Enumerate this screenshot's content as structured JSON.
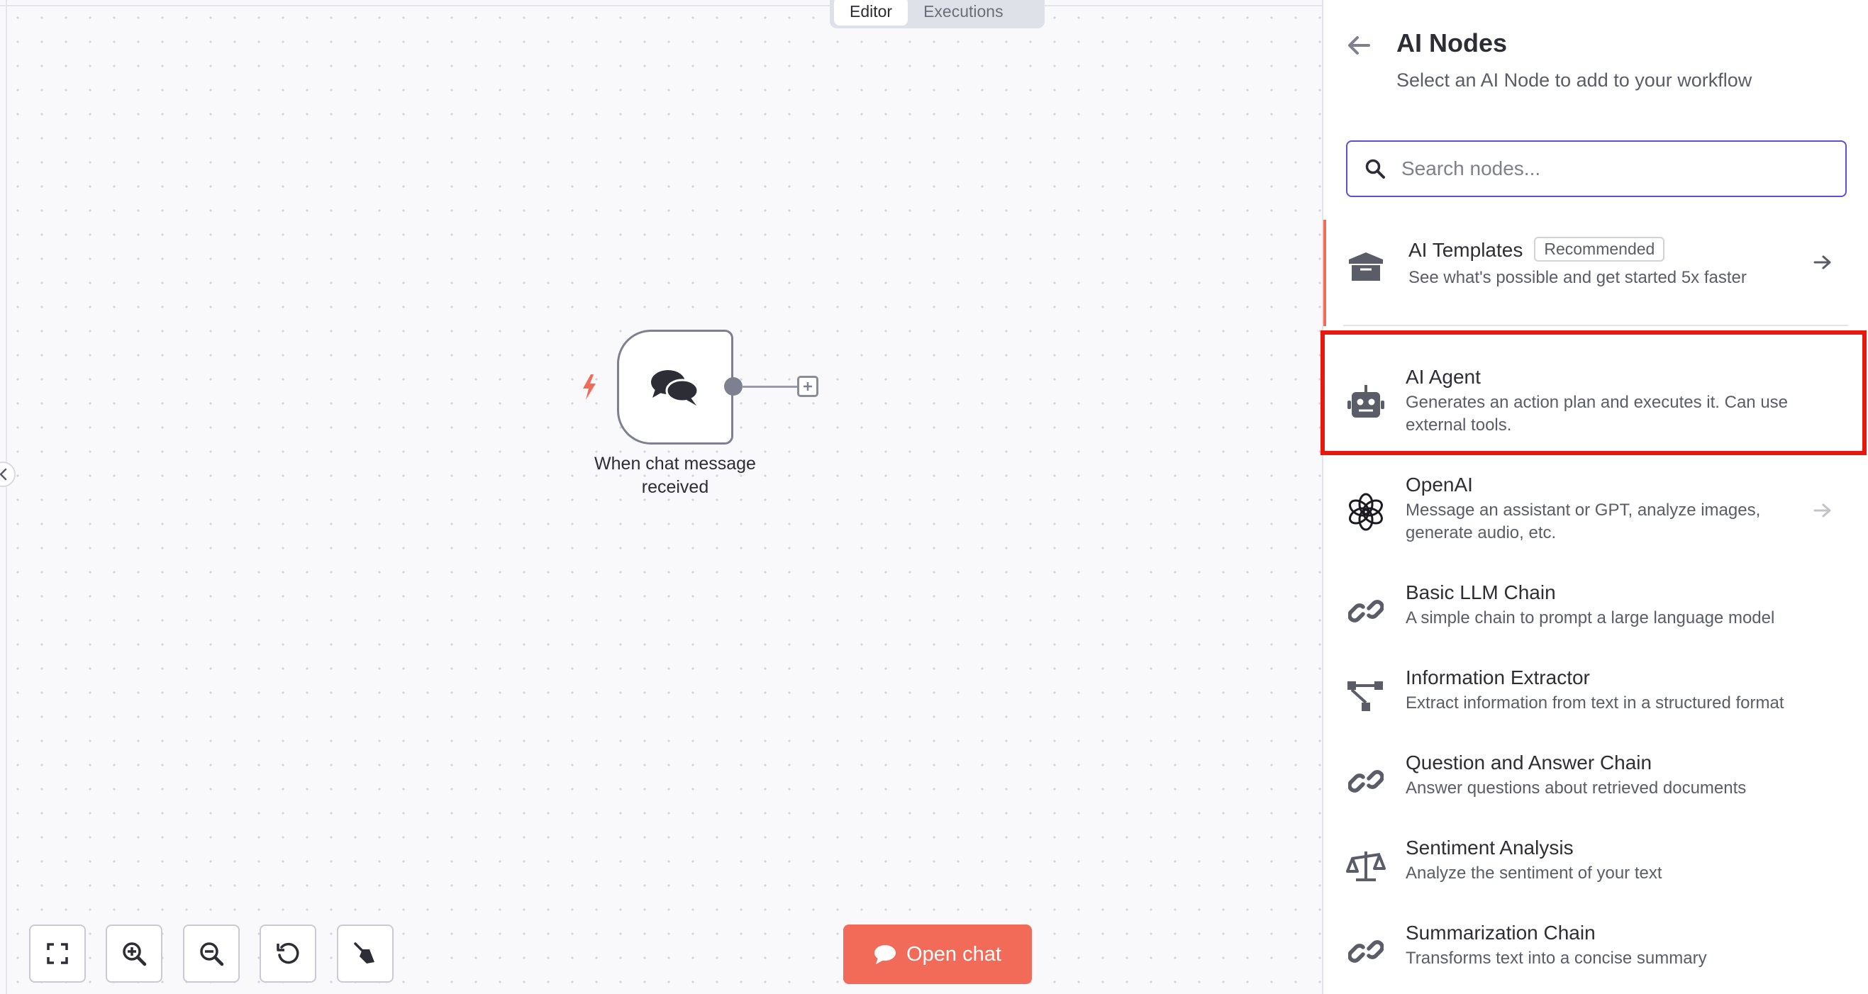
{
  "tabs": {
    "editor": "Editor",
    "executions": "Executions"
  },
  "canvas": {
    "node_label": "When chat message received",
    "open_chat_label": "Open chat",
    "colors": {
      "accent": "#f26b58",
      "node_border": "#7e8090"
    }
  },
  "controls": {
    "fit_icon": "fit-view-icon",
    "zoom_in_icon": "zoom-in-icon",
    "zoom_out_icon": "zoom-out-icon",
    "reset_icon": "reset-zoom-icon",
    "clean_icon": "tidy-up-icon"
  },
  "panel": {
    "title": "AI Nodes",
    "subtitle": "Select an AI Node to add to your workflow",
    "search_placeholder": "Search nodes...",
    "templates": {
      "title": "AI Templates",
      "badge": "Recommended",
      "description": "See what's possible and get started 5x faster"
    },
    "items": [
      {
        "title": "AI Agent",
        "description": "Generates an action plan and executes it. Can use external tools.",
        "icon": "robot-icon"
      },
      {
        "title": "OpenAI",
        "description": "Message an assistant or GPT, analyze images, generate audio, etc.",
        "icon": "openai-icon"
      },
      {
        "title": "Basic LLM Chain",
        "description": "A simple chain to prompt a large language model",
        "icon": "link-icon"
      },
      {
        "title": "Information Extractor",
        "description": "Extract information from text in a structured format",
        "icon": "tree-icon"
      },
      {
        "title": "Question and Answer Chain",
        "description": "Answer questions about retrieved documents",
        "icon": "link-icon"
      },
      {
        "title": "Sentiment Analysis",
        "description": "Analyze the sentiment of your text",
        "icon": "scale-icon"
      },
      {
        "title": "Summarization Chain",
        "description": "Transforms text into a concise summary",
        "icon": "link-icon"
      }
    ],
    "highlight_color": "#e8180c"
  }
}
